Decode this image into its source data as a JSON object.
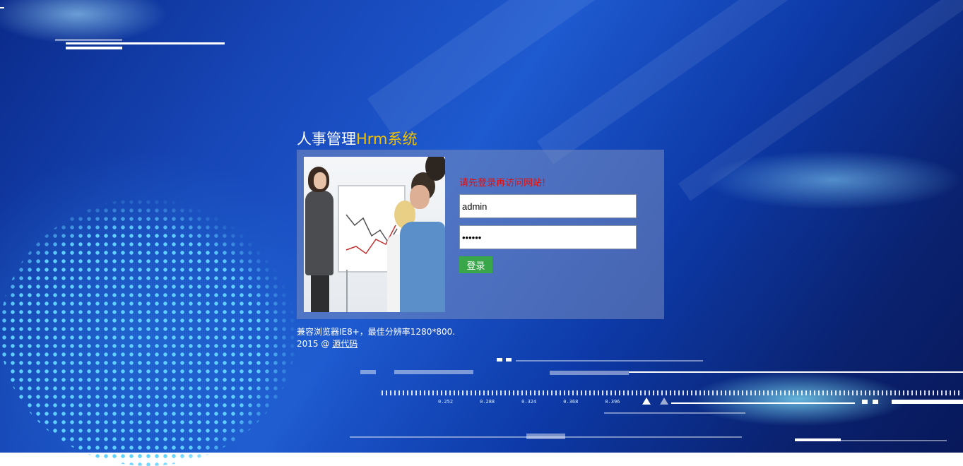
{
  "header": {
    "title_prefix": "人事管理",
    "title_accent": "Hrm系统"
  },
  "login": {
    "notice": "请先登录再访问网站!",
    "username_value": "admin",
    "password_value": "123456",
    "submit_label": "登录"
  },
  "footer": {
    "compat_text": "兼容浏览器IE8+，最佳分辨率1280*800.",
    "copyright": "2015 @",
    "source_link": "源代码"
  },
  "background": {
    "scale_labels": [
      "0.252",
      "0.288",
      "0.324",
      "0.368",
      "0.396"
    ]
  },
  "colors": {
    "title_accent": "#f2c200",
    "notice": "#e01010",
    "login_button": "#3aa64a"
  }
}
